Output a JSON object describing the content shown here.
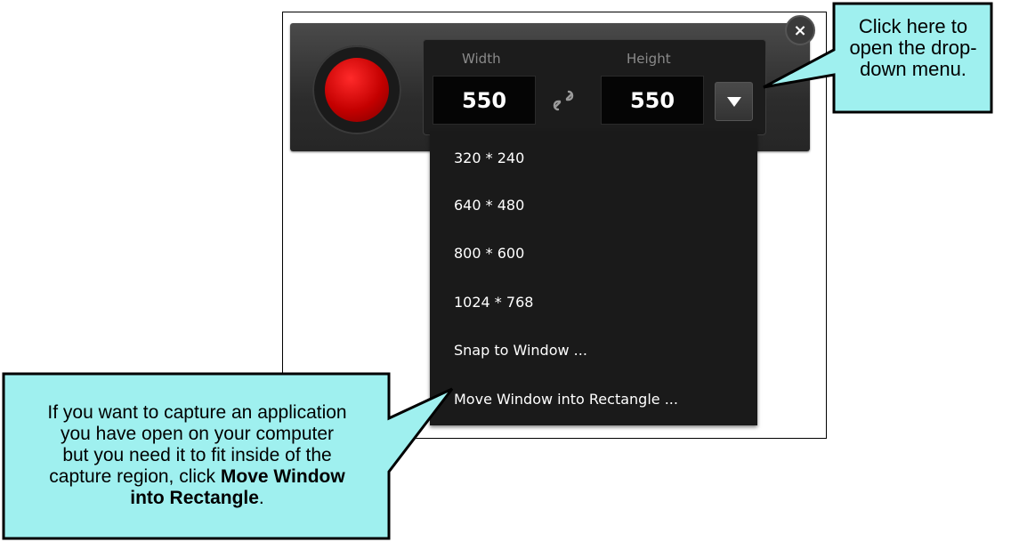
{
  "recorder": {
    "width_label": "Width",
    "height_label": "Height",
    "width_value": "550",
    "height_value": "550",
    "close_symbol": "×",
    "icons": {
      "record": "record-button-icon",
      "link": "link-chain-icon",
      "dropdown": "triangle-down-icon",
      "close": "close-icon"
    }
  },
  "menu": {
    "items": [
      "320 * 240",
      "640 * 480",
      "800 * 600",
      "1024 * 768",
      "Snap to Window ...",
      "Move Window into Rectangle ..."
    ]
  },
  "callouts": {
    "dropdown_note": {
      "line1": "Click here to",
      "line2": "open the drop-",
      "line3": "down menu."
    },
    "move_window_note": {
      "line1": "If you want to capture an application",
      "line2": "you have open on your computer",
      "line3": "but you need it to fit inside of the",
      "line4_prefix": "capture region, click ",
      "line4_bold": "Move Window",
      "line5_bold": "into Rectangle",
      "line5_suffix": "."
    },
    "fill_color": "#9ff0ef"
  }
}
